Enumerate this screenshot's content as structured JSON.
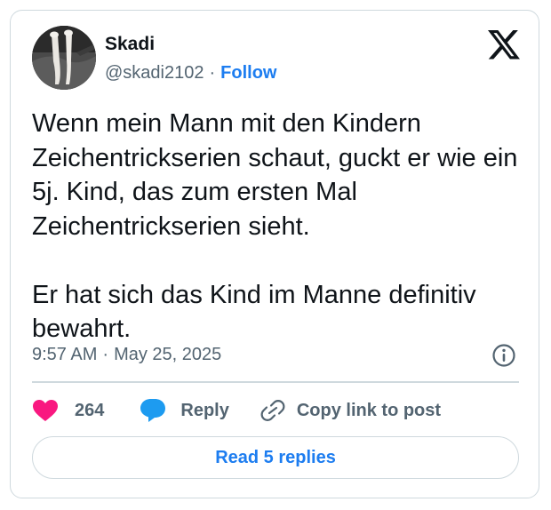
{
  "author": {
    "display_name": "Skadi",
    "handle": "@skadi2102",
    "separator": "·",
    "follow_label": "Follow"
  },
  "tweet": {
    "paragraphs": [
      "Wenn mein Mann mit den Kindern Zeichentrickserien schaut, guckt er wie ein 5j. Kind, das zum ersten Mal Zeichentrickserien sieht.",
      "Er hat sich das Kind im Manne definitiv bewahrt."
    ],
    "time": "9:57 AM",
    "separator": "·",
    "date": "May 25, 2025"
  },
  "actions": {
    "like_count": "264",
    "reply_label": "Reply",
    "copy_link_label": "Copy link to post"
  },
  "read_replies_label": "Read 5 replies",
  "colors": {
    "accent_blue": "#1d7df0",
    "like_pink": "#f91880",
    "reply_blue": "#1d9bf0",
    "muted_text": "#536471",
    "border": "#cfd9de"
  },
  "icons": {
    "logo": "x-logo-icon",
    "info": "info-icon",
    "like": "heart-icon",
    "reply": "speech-bubble-icon",
    "copy": "link-icon"
  }
}
